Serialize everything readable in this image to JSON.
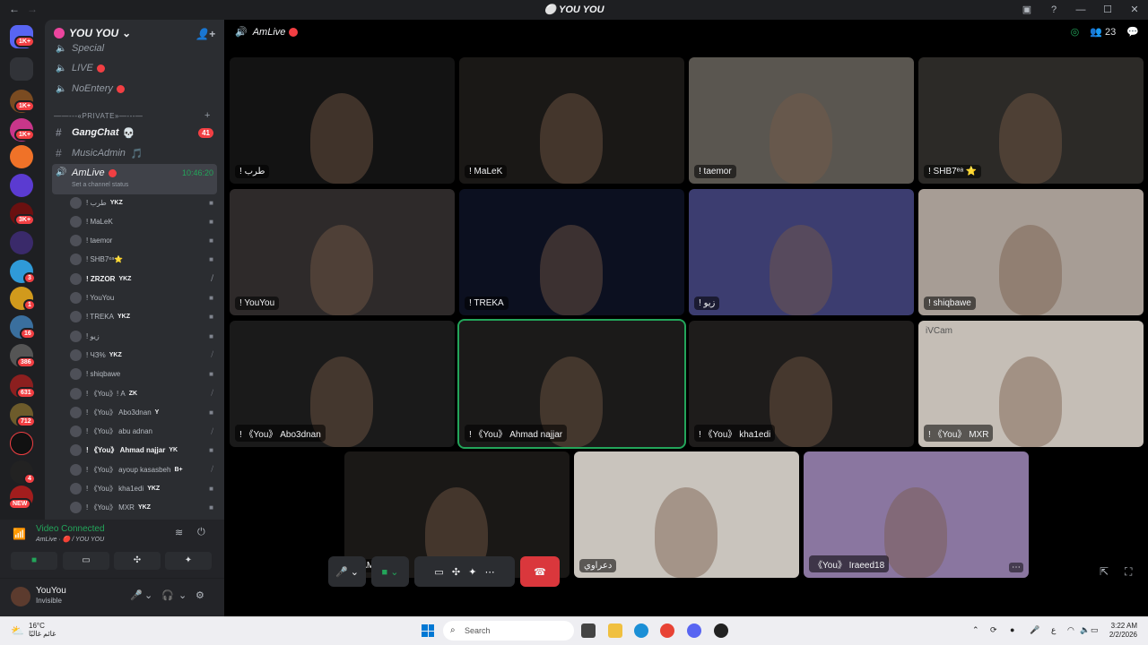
{
  "window": {
    "title": "YOU YOU",
    "back": "←",
    "forward": "→"
  },
  "server": {
    "name": "YOU YOU",
    "chevron": "⌄"
  },
  "channels": [
    {
      "name": "Special",
      "kind": "voice"
    },
    {
      "name": "LIVE",
      "kind": "voice",
      "live": true
    },
    {
      "name": "NoEntery",
      "kind": "voice",
      "live": true
    }
  ],
  "category_private": "——---«PRIVATE»—---—",
  "text_channel": {
    "name": "GangChat",
    "badge": "41",
    "emoji": "💀"
  },
  "music_channel": {
    "name": "MusicAdmin",
    "emoji": "🎵"
  },
  "active_channel": {
    "name": "AmLive",
    "time": "10:46:20",
    "status": "Set a channel status"
  },
  "guild_badges": [
    "1K+",
    "1K+",
    "1K+",
    "3K+",
    "3",
    "1",
    "16",
    "386",
    "631",
    "712",
    "4",
    "NEW"
  ],
  "voice_users": [
    {
      "name": "! طرب",
      "tag": "YKZ",
      "cam": true
    },
    {
      "name": "! MaLeK",
      "tag": "",
      "cam": true
    },
    {
      "name": "! taemor",
      "tag": "",
      "cam": true
    },
    {
      "name": "! SHB7ᵉᵃ⭐",
      "tag": "",
      "cam": true
    },
    {
      "name": "! ZRZOR",
      "tag": "YKZ",
      "cam": false,
      "bold": true
    },
    {
      "name": "! YouYou",
      "tag": "",
      "cam": true
    },
    {
      "name": "! TREKA",
      "tag": "YKZ",
      "cam": true
    },
    {
      "name": "! زيو",
      "tag": "",
      "cam": true
    },
    {
      "name": "! ЧЗ%",
      "tag": "YKZ",
      "cam": false
    },
    {
      "name": "! shiqbawe",
      "tag": "",
      "cam": true
    },
    {
      "name": "! 《You》! A",
      "tag": "ZK",
      "cam": false
    },
    {
      "name": "! 《You》 Abo3dnan",
      "tag": "Y",
      "cam": true
    },
    {
      "name": "! 《You》 abu adnan",
      "tag": "",
      "cam": false
    },
    {
      "name": "! 《You》 Ahmad najjar",
      "tag": "YK",
      "cam": true,
      "bold": true
    },
    {
      "name": "! 《You》 ayoup kasasbeh",
      "tag": "B+",
      "cam": false
    },
    {
      "name": "! 《You》 kha1edi",
      "tag": "YKZ",
      "cam": true
    },
    {
      "name": "! 《You》 MXR",
      "tag": "YKZ",
      "cam": true
    }
  ],
  "voice_panel": {
    "connected": "Video Connected",
    "location": "AmLive · 🔴 / YOU YOU"
  },
  "user": {
    "name": "YouYou",
    "status": "Invisible"
  },
  "stage": {
    "channel": "AmLive",
    "participants_count": "23",
    "tiles": [
      {
        "label": "! طرب",
        "bg": "#131313"
      },
      {
        "label": "! MaLeK",
        "bg": "#1a1816"
      },
      {
        "label": "! taemor",
        "bg": "#5a5650"
      },
      {
        "label": "! SHB7ᵉᵃ ⭐",
        "bg": "#2c2a27"
      },
      {
        "label": "! YouYou",
        "bg": "#2e2a2a"
      },
      {
        "label": "! TREKA",
        "bg": "#0c1020"
      },
      {
        "label": "! زيو",
        "bg": "#3c3d70"
      },
      {
        "label": "! shiqbawe",
        "bg": "#a79d95"
      },
      {
        "label": "! 《You》 Abo3dnan",
        "bg": "#1a1a1a"
      },
      {
        "label": "! 《You》 Ahmad najjar",
        "bg": "#1b1a19"
      },
      {
        "label": "! 《You》 kha1edi",
        "bg": "#1e1c1b"
      },
      {
        "label": "! 《You》 MXR",
        "bg": "#c5beb6",
        "overlay": "iVCam"
      },
      {
        "label": "HAMOD",
        "bg": "#1a1816"
      },
      {
        "label": "دعراوي",
        "bg": "#c9c4bd"
      },
      {
        "label": "《You》 Iraeed18",
        "bg": "#8a76a0"
      }
    ]
  },
  "taskbar": {
    "temp": "16°C",
    "weather_text": "غائم غالبًا",
    "search": "Search",
    "lang": "ع",
    "time": "3:22 AM",
    "date": "2/2/2026"
  },
  "colors": {
    "accent_green": "#23a55a",
    "danger": "#da373c",
    "blurple": "#5865f2"
  }
}
